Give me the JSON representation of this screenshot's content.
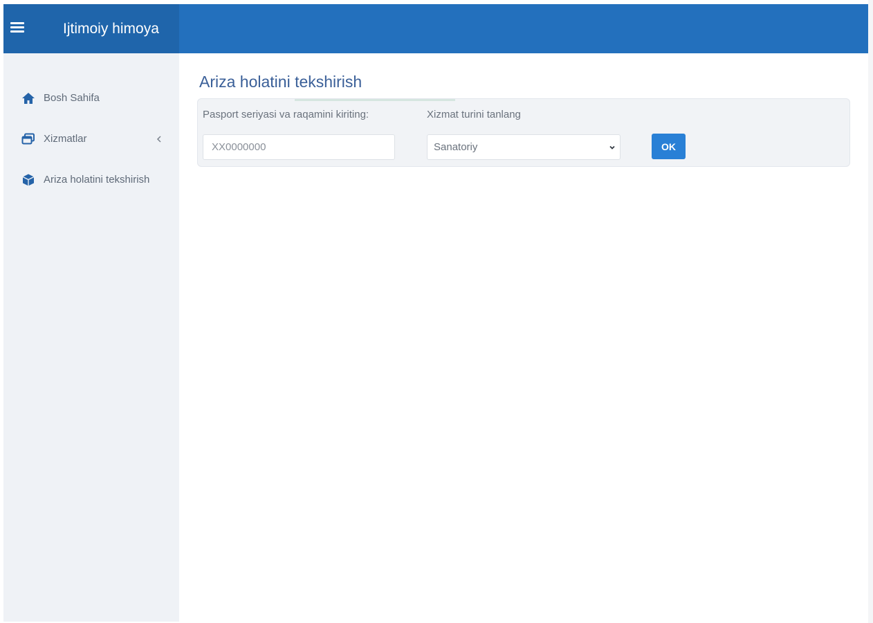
{
  "header": {
    "app_title": "Ijtimoiy himoya",
    "menu_icon": "hamburger-menu-icon",
    "background_color": "#2370bd",
    "brand_background_color": "#1f65ab"
  },
  "sidebar": {
    "items": [
      {
        "label": "Bosh Sahifa",
        "icon": "home-icon"
      },
      {
        "label": "Xizmatlar",
        "icon": "windows-icon",
        "expand_icon": "chevron-left-icon"
      },
      {
        "label": "Ariza holatini tekshirish",
        "icon": "box-icon"
      }
    ]
  },
  "main": {
    "page_title": "Ariza holatini tekshirish",
    "form": {
      "passport_label": "Pasport seriyasi va raqamini kiriting:",
      "passport_placeholder": "XX0000000",
      "passport_value": "",
      "service_label": "Xizmat turini tanlang",
      "service_selected": "Sanatoriy",
      "submit_label": "OK",
      "submit_color": "#2980d6"
    }
  }
}
